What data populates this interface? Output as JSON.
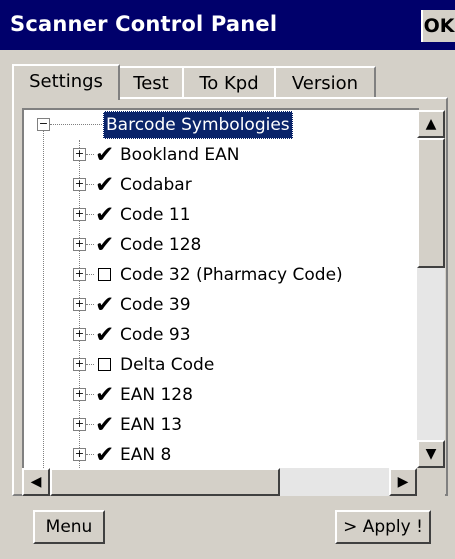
{
  "window": {
    "title": "Scanner Control Panel",
    "ok_label": "OK"
  },
  "tabs": [
    "Settings",
    "Test",
    "To Kpd",
    "Version"
  ],
  "tree": {
    "root": "Barcode Symbologies",
    "items": [
      {
        "label": "Bookland EAN",
        "checked": true
      },
      {
        "label": "Codabar",
        "checked": true
      },
      {
        "label": "Code 11",
        "checked": true
      },
      {
        "label": "Code 128",
        "checked": true
      },
      {
        "label": "Code 32 (Pharmacy Code)",
        "checked": false
      },
      {
        "label": "Code 39",
        "checked": true
      },
      {
        "label": "Code 93",
        "checked": true
      },
      {
        "label": "Delta Code",
        "checked": false
      },
      {
        "label": "EAN 128",
        "checked": true
      },
      {
        "label": "EAN 13",
        "checked": true
      },
      {
        "label": "EAN 8",
        "checked": true
      }
    ]
  },
  "buttons": {
    "menu": "Menu",
    "apply": "> Apply !"
  },
  "icons": {
    "expand": "plus-box-icon",
    "collapse": "minus-box-icon",
    "check": "checkmark-icon"
  },
  "colors": {
    "titlebar": "#00006b",
    "selection": "#0a246a",
    "face": "#d4d0c8"
  }
}
